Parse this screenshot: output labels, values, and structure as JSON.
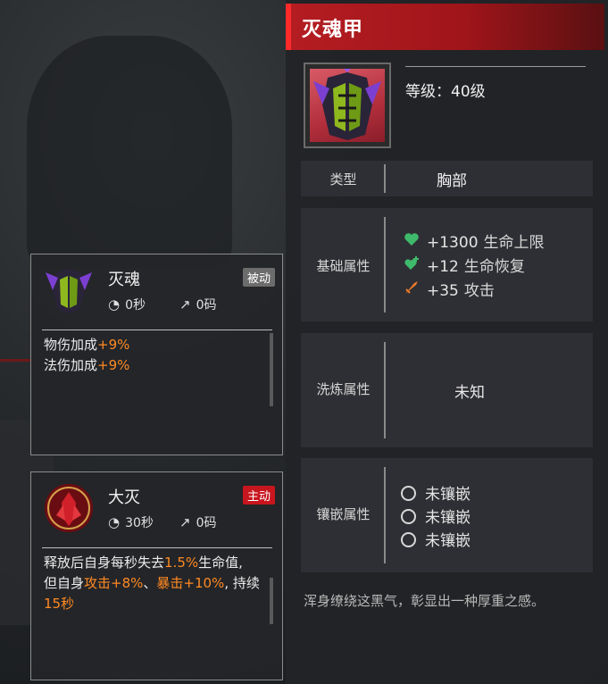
{
  "item": {
    "title": "灭魂甲",
    "level_label": "等级：40级",
    "type_label": "类型",
    "type_value": "胸部",
    "basic_label": "基础属性",
    "basic_attrs": [
      {
        "value": "+1300",
        "name": "生命上限",
        "icon": "heart-icon",
        "color": "#3fb96b"
      },
      {
        "value": "+12",
        "name": "生命恢复",
        "icon": "heart-plus-icon",
        "color": "#3fb96b"
      },
      {
        "value": "+35",
        "name": "攻击",
        "icon": "sword-icon",
        "color": "#f07a2a"
      }
    ],
    "refine_label": "洗炼属性",
    "refine_value": "未知",
    "socket_label": "镶嵌属性",
    "sockets": [
      "未镶嵌",
      "未镶嵌",
      "未镶嵌"
    ],
    "flavor": "浑身缭绕这黑气，彰显出一种厚重之感。"
  },
  "skills": {
    "passive": {
      "name": "灭魂",
      "badge": "被动",
      "cooldown": "0秒",
      "cost": "0码",
      "desc": [
        {
          "text": "物伤加成",
          "hl": "+9%"
        },
        {
          "text": "法伤加成",
          "hl": "+9%"
        }
      ]
    },
    "active": {
      "name": "大灭",
      "badge": "主动",
      "cooldown": "30秒",
      "cost": "0码",
      "desc_parts": {
        "p1": "释放后自身每秒失去",
        "h1": "1.5%",
        "p2": "生命值,",
        "p3": "但自身",
        "h2": "攻击+8%",
        "p4": "、",
        "h3": "暴击+10%",
        "p5": ", 持续",
        "h4": "15秒"
      }
    }
  },
  "colors": {
    "title_bar": "#b41d22",
    "highlight": "#ff8a22",
    "active_badge": "#c8161e",
    "passive_badge": "#6c6c6c"
  }
}
